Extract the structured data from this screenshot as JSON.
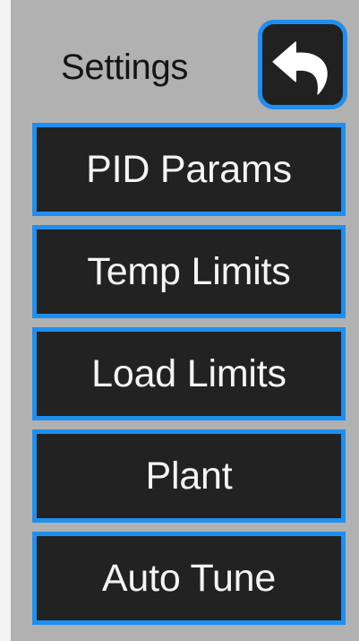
{
  "header": {
    "title": "Settings",
    "back_icon": "return-arrow-icon"
  },
  "menu": {
    "items": [
      {
        "label": "PID Params"
      },
      {
        "label": "Temp Limits"
      },
      {
        "label": "Load Limits"
      },
      {
        "label": "Plant"
      },
      {
        "label": "Auto Tune"
      }
    ]
  },
  "colors": {
    "screen_background": "#b1b1b1",
    "button_background": "#222222",
    "button_border": "#1e8ff0",
    "button_text": "#f4f4f4",
    "title_text": "#141414"
  }
}
